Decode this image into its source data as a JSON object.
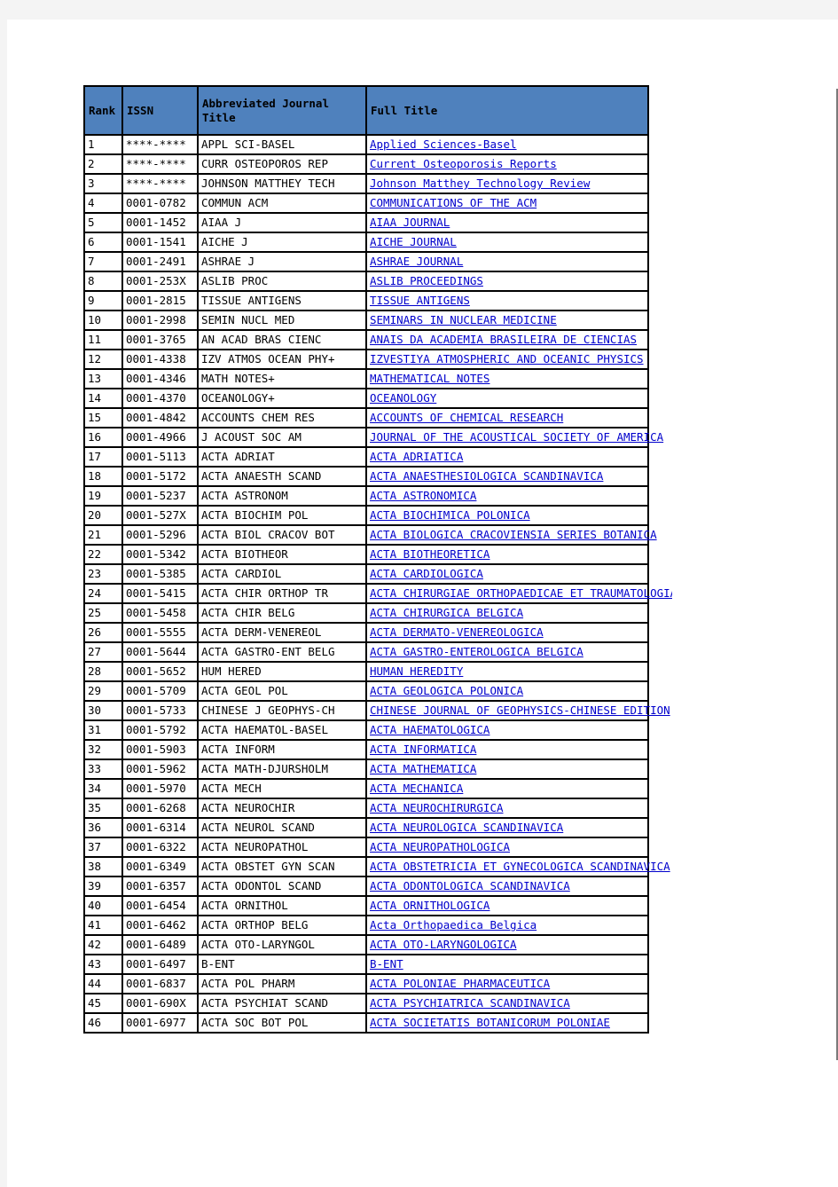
{
  "document": {
    "page_background": "#f4f4f4",
    "sheet_background": "#ffffff"
  },
  "table": {
    "name": "journal-abbreviation-table",
    "header_fill": "#4F81BD",
    "link_color": "#0000CC",
    "border_color": "#000000",
    "columns": [
      {
        "key": "rank",
        "label": "Rank"
      },
      {
        "key": "issn",
        "label": "ISSN"
      },
      {
        "key": "abbr",
        "label": "Abbreviated Journal Title"
      },
      {
        "key": "full",
        "label": "Full Title"
      }
    ],
    "rows": [
      {
        "rank": "1",
        "issn": "****-****",
        "abbr": "APPL SCI-BASEL",
        "full": "Applied Sciences-Basel",
        "link": true
      },
      {
        "rank": "2",
        "issn": "****-****",
        "abbr": "CURR OSTEOPOROS REP",
        "full": "Current Osteoporosis Reports",
        "link": true
      },
      {
        "rank": "3",
        "issn": "****-****",
        "abbr": "JOHNSON MATTHEY TECH",
        "full": "Johnson Matthey Technology Review",
        "link": true
      },
      {
        "rank": "4",
        "issn": "0001-0782",
        "abbr": "COMMUN ACM",
        "full": "COMMUNICATIONS OF THE ACM",
        "link": true
      },
      {
        "rank": "5",
        "issn": "0001-1452",
        "abbr": "AIAA J",
        "full": "AIAA JOURNAL",
        "link": true
      },
      {
        "rank": "6",
        "issn": "0001-1541",
        "abbr": "AICHE J",
        "full": "AICHE JOURNAL",
        "link": true
      },
      {
        "rank": "7",
        "issn": "0001-2491",
        "abbr": "ASHRAE J",
        "full": "ASHRAE JOURNAL",
        "link": true
      },
      {
        "rank": "8",
        "issn": "0001-253X",
        "abbr": "ASLIB PROC",
        "full": "ASLIB PROCEEDINGS",
        "link": true
      },
      {
        "rank": "9",
        "issn": "0001-2815",
        "abbr": "TISSUE ANTIGENS",
        "full": "TISSUE ANTIGENS",
        "link": true
      },
      {
        "rank": "10",
        "issn": "0001-2998",
        "abbr": "SEMIN NUCL MED",
        "full": "SEMINARS IN NUCLEAR MEDICINE",
        "link": true
      },
      {
        "rank": "11",
        "issn": "0001-3765",
        "abbr": "AN ACAD BRAS CIENC",
        "full": "ANAIS DA ACADEMIA BRASILEIRA DE CIENCIAS",
        "link": true
      },
      {
        "rank": "12",
        "issn": "0001-4338",
        "abbr": "IZV ATMOS OCEAN PHY+",
        "full": "IZVESTIYA ATMOSPHERIC AND OCEANIC PHYSICS",
        "link": true
      },
      {
        "rank": "13",
        "issn": "0001-4346",
        "abbr": "MATH NOTES+",
        "full": "MATHEMATICAL NOTES",
        "link": true
      },
      {
        "rank": "14",
        "issn": "0001-4370",
        "abbr": "OCEANOLOGY+",
        "full": "OCEANOLOGY",
        "link": true
      },
      {
        "rank": "15",
        "issn": "0001-4842",
        "abbr": "ACCOUNTS CHEM RES",
        "full": "ACCOUNTS OF CHEMICAL RESEARCH",
        "link": true
      },
      {
        "rank": "16",
        "issn": "0001-4966",
        "abbr": "J ACOUST SOC AM",
        "full": "JOURNAL OF THE ACOUSTICAL SOCIETY OF AMERICA",
        "link": true
      },
      {
        "rank": "17",
        "issn": "0001-5113",
        "abbr": "ACTA ADRIAT",
        "full": "ACTA ADRIATICA",
        "link": true
      },
      {
        "rank": "18",
        "issn": "0001-5172",
        "abbr": "ACTA ANAESTH SCAND",
        "full": "ACTA ANAESTHESIOLOGICA SCANDINAVICA",
        "link": true
      },
      {
        "rank": "19",
        "issn": "0001-5237",
        "abbr": "ACTA ASTRONOM",
        "full": "ACTA ASTRONOMICA",
        "link": true
      },
      {
        "rank": "20",
        "issn": "0001-527X",
        "abbr": "ACTA BIOCHIM POL",
        "full": "ACTA BIOCHIMICA POLONICA",
        "link": true
      },
      {
        "rank": "21",
        "issn": "0001-5296",
        "abbr": "ACTA BIOL CRACOV BOT",
        "full": "ACTA BIOLOGICA CRACOVIENSIA SERIES BOTANICA",
        "link": true
      },
      {
        "rank": "22",
        "issn": "0001-5342",
        "abbr": "ACTA BIOTHEOR",
        "full": "ACTA BIOTHEORETICA",
        "link": true
      },
      {
        "rank": "23",
        "issn": "0001-5385",
        "abbr": "ACTA CARDIOL",
        "full": "ACTA CARDIOLOGICA",
        "link": true
      },
      {
        "rank": "24",
        "issn": "0001-5415",
        "abbr": "ACTA CHIR ORTHOP TR",
        "full": "ACTA CHIRURGIAE ORTHOPAEDICAE ET TRAUMATOLOGIAE CECHOSLOVACA",
        "link": true
      },
      {
        "rank": "25",
        "issn": "0001-5458",
        "abbr": "ACTA CHIR BELG",
        "full": "ACTA CHIRURGICA BELGICA",
        "link": true
      },
      {
        "rank": "26",
        "issn": "0001-5555",
        "abbr": "ACTA DERM-VENEREOL",
        "full": "ACTA DERMATO-VENEREOLOGICA",
        "link": true
      },
      {
        "rank": "27",
        "issn": "0001-5644",
        "abbr": "ACTA GASTRO-ENT BELG",
        "full": "ACTA GASTRO-ENTEROLOGICA BELGICA",
        "link": true
      },
      {
        "rank": "28",
        "issn": "0001-5652",
        "abbr": "HUM HERED",
        "full": "HUMAN HEREDITY",
        "link": true
      },
      {
        "rank": "29",
        "issn": "0001-5709",
        "abbr": "ACTA GEOL POL",
        "full": "ACTA GEOLOGICA POLONICA",
        "link": true
      },
      {
        "rank": "30",
        "issn": "0001-5733",
        "abbr": "CHINESE J GEOPHYS-CH",
        "full": "CHINESE JOURNAL OF GEOPHYSICS-CHINESE EDITION",
        "link": true
      },
      {
        "rank": "31",
        "issn": "0001-5792",
        "abbr": "ACTA HAEMATOL-BASEL",
        "full": "ACTA HAEMATOLOGICA",
        "link": true
      },
      {
        "rank": "32",
        "issn": "0001-5903",
        "abbr": "ACTA INFORM",
        "full": "ACTA INFORMATICA",
        "link": true
      },
      {
        "rank": "33",
        "issn": "0001-5962",
        "abbr": "ACTA MATH-DJURSHOLM",
        "full": "ACTA MATHEMATICA",
        "link": true
      },
      {
        "rank": "34",
        "issn": "0001-5970",
        "abbr": "ACTA MECH",
        "full": "ACTA MECHANICA",
        "link": true
      },
      {
        "rank": "35",
        "issn": "0001-6268",
        "abbr": "ACTA NEUROCHIR",
        "full": "ACTA NEUROCHIRURGICA",
        "link": true
      },
      {
        "rank": "36",
        "issn": "0001-6314",
        "abbr": "ACTA NEUROL SCAND",
        "full": "ACTA NEUROLOGICA SCANDINAVICA",
        "link": true
      },
      {
        "rank": "37",
        "issn": "0001-6322",
        "abbr": "ACTA NEUROPATHOL",
        "full": "ACTA NEUROPATHOLOGICA",
        "link": true
      },
      {
        "rank": "38",
        "issn": "0001-6349",
        "abbr": "ACTA OBSTET GYN SCAN",
        "full": "ACTA OBSTETRICIA ET GYNECOLOGICA SCANDINAVICA",
        "link": true
      },
      {
        "rank": "39",
        "issn": "0001-6357",
        "abbr": "ACTA ODONTOL SCAND",
        "full": "ACTA ODONTOLOGICA SCANDINAVICA",
        "link": true
      },
      {
        "rank": "40",
        "issn": "0001-6454",
        "abbr": "ACTA ORNITHOL",
        "full": "ACTA ORNITHOLOGICA",
        "link": true
      },
      {
        "rank": "41",
        "issn": "0001-6462",
        "abbr": "ACTA ORTHOP BELG",
        "full": "Acta Orthopaedica Belgica",
        "link": true
      },
      {
        "rank": "42",
        "issn": "0001-6489",
        "abbr": "ACTA OTO-LARYNGOL",
        "full": "ACTA OTO-LARYNGOLOGICA",
        "link": true
      },
      {
        "rank": "43",
        "issn": "0001-6497",
        "abbr": "B-ENT",
        "full": "B-ENT",
        "link": true
      },
      {
        "rank": "44",
        "issn": "0001-6837",
        "abbr": "ACTA POL PHARM",
        "full": "ACTA POLONIAE PHARMACEUTICA",
        "link": true
      },
      {
        "rank": "45",
        "issn": "0001-690X",
        "abbr": "ACTA PSYCHIAT SCAND",
        "full": "ACTA PSYCHIATRICA SCANDINAVICA",
        "link": true
      },
      {
        "rank": "46",
        "issn": "0001-6977",
        "abbr": "ACTA SOC BOT POL",
        "full": "ACTA SOCIETATIS BOTANICORUM POLONIAE",
        "link": true
      }
    ]
  }
}
